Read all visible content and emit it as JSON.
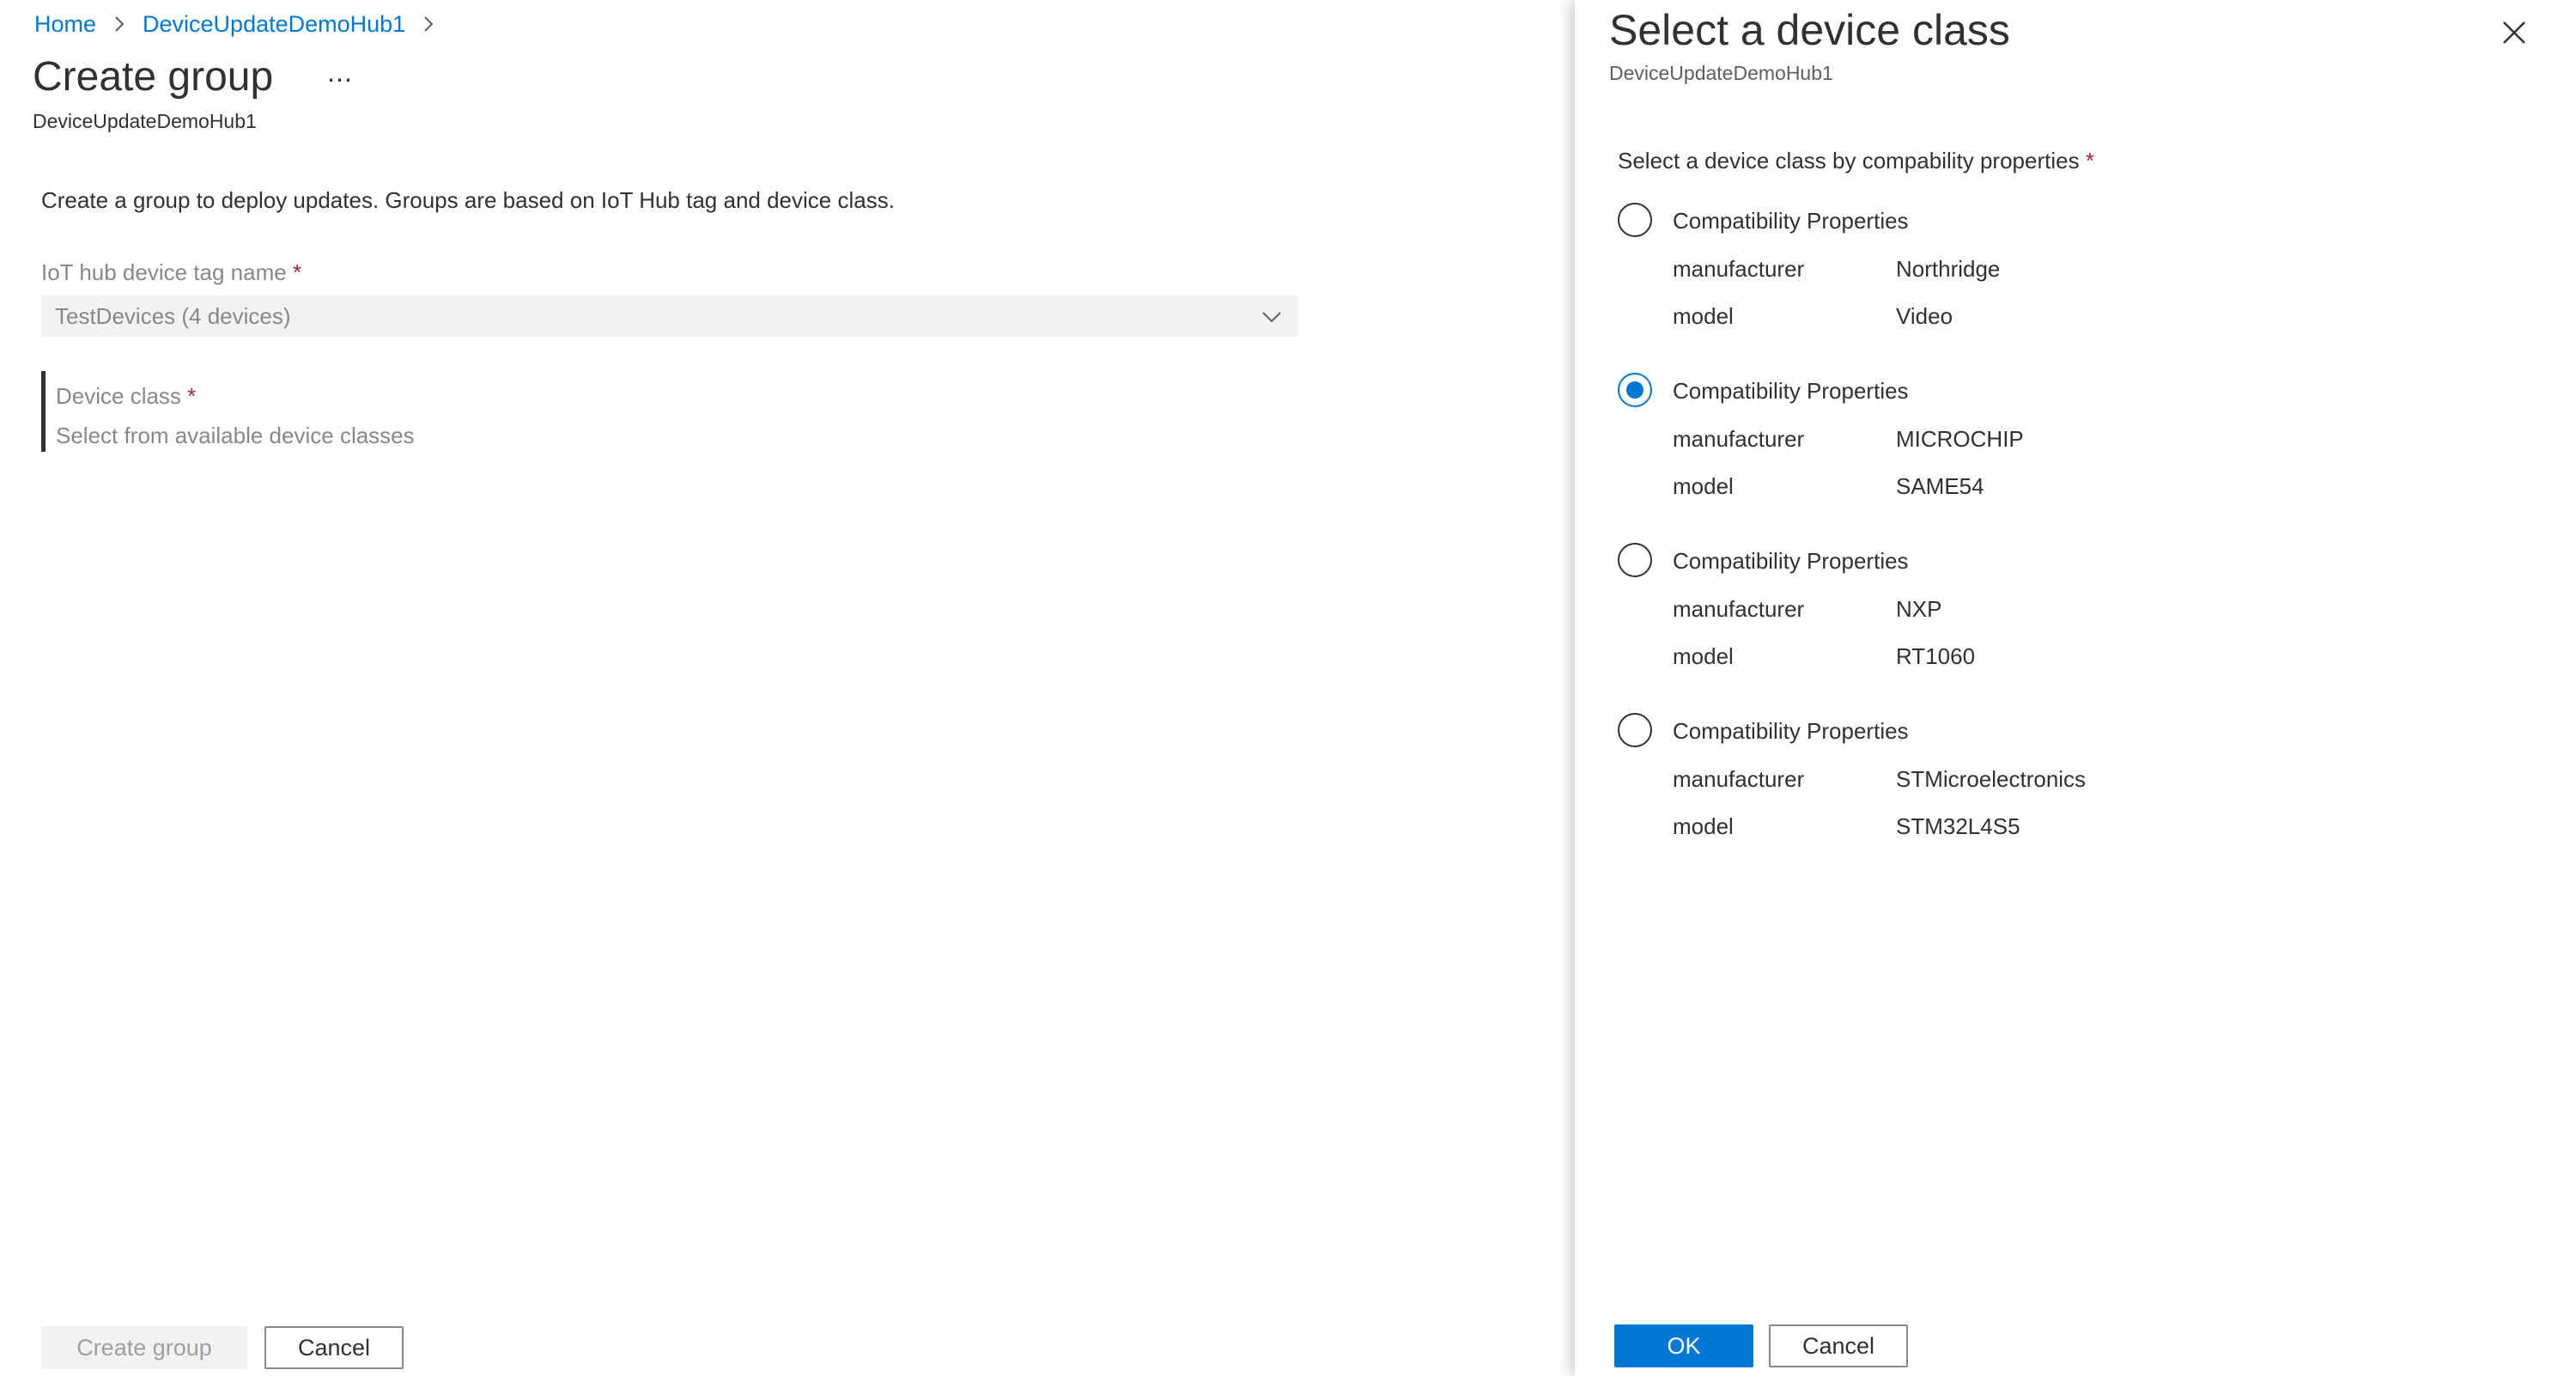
{
  "breadcrumb": {
    "home": "Home",
    "hub": "DeviceUpdateDemoHub1"
  },
  "page": {
    "title": "Create group",
    "more": "...",
    "subtitle": "DeviceUpdateDemoHub1",
    "description": "Create a group to deploy updates. Groups are based on IoT Hub tag and device class."
  },
  "form": {
    "tag_label": "IoT hub device tag name",
    "tag_value": "TestDevices (4 devices)",
    "class_label": "Device class",
    "class_hint": "Select from available device classes",
    "required_marker": "*"
  },
  "footer": {
    "create_label": "Create group",
    "cancel_label": "Cancel"
  },
  "panel": {
    "title": "Select a device class",
    "subtitle": "DeviceUpdateDemoHub1",
    "prompt": "Select a device class by compability properties",
    "required_marker": "*",
    "close_icon": "close-icon",
    "options": [
      {
        "title": "Compatibility Properties",
        "manufacturer_key": "manufacturer",
        "manufacturer": "Northridge",
        "model_key": "model",
        "model": "Video",
        "selected": false
      },
      {
        "title": "Compatibility Properties",
        "manufacturer_key": "manufacturer",
        "manufacturer": "MICROCHIP",
        "model_key": "model",
        "model": "SAME54",
        "selected": true
      },
      {
        "title": "Compatibility Properties",
        "manufacturer_key": "manufacturer",
        "manufacturer": "NXP",
        "model_key": "model",
        "model": "RT1060",
        "selected": false
      },
      {
        "title": "Compatibility Properties",
        "manufacturer_key": "manufacturer",
        "manufacturer": "STMicroelectronics",
        "model_key": "model",
        "model": "STM32L4S5",
        "selected": false
      }
    ],
    "ok_label": "OK",
    "cancel_label": "Cancel"
  },
  "colors": {
    "accent": "#0078d4",
    "required": "#a4262c",
    "disabled_text": "#8a8886"
  }
}
